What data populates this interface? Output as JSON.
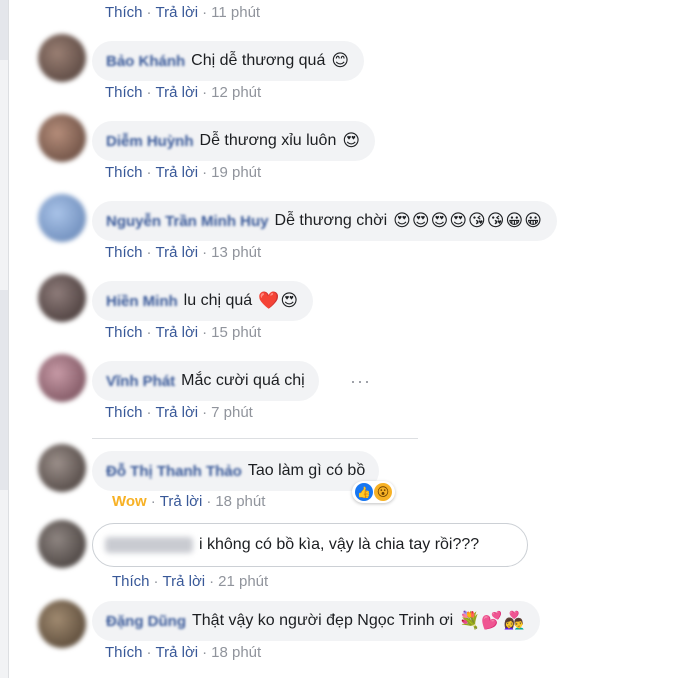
{
  "labels": {
    "like": "Thích",
    "reply": "Trả lời",
    "wow": "Wow",
    "sep": "·",
    "more": "···"
  },
  "top_time": "11 phút",
  "comments": [
    {
      "name": "Bảo Khánh",
      "text": "Chị dễ thương quá",
      "emojis": "😊",
      "time": "12 phút"
    },
    {
      "name": "Diễm Huỳnh",
      "text": "Dễ thương xỉu luôn",
      "emojis": "😍",
      "time": "19 phút"
    },
    {
      "name": "Nguyễn Trần Minh Huy",
      "text": "Dễ thương chời",
      "emojis": "😍😍😍😍😘😘😀😀",
      "time": "13 phút"
    },
    {
      "name": "Hiền Minh",
      "text": "lu chị quá",
      "emojis": "❤️😍",
      "time": "15 phút"
    },
    {
      "name": "Vĩnh Phát",
      "text": "Mắc cười quá chị",
      "emojis": "",
      "time": "7 phút"
    },
    {
      "name": "Đỗ Thị Thanh Thảo",
      "text": "Tao làm gì có bồ",
      "emojis": "",
      "time": "18 phút"
    },
    {
      "name": "",
      "text": "i không có bồ kìa, vậy là chia tay rồi???",
      "emojis": "",
      "time": "21 phút"
    },
    {
      "name": "Đặng Dũng",
      "text": "Thật vậy ko người đẹp Ngọc Trinh ơi",
      "emojis": "💐💕👩‍❤️‍👨",
      "time": "18 phút"
    }
  ],
  "colors": {
    "link": "#385898",
    "bubble": "#f2f3f5",
    "muted": "#90949c",
    "wow": "#f7b125",
    "like_blue": "#1877f2"
  }
}
